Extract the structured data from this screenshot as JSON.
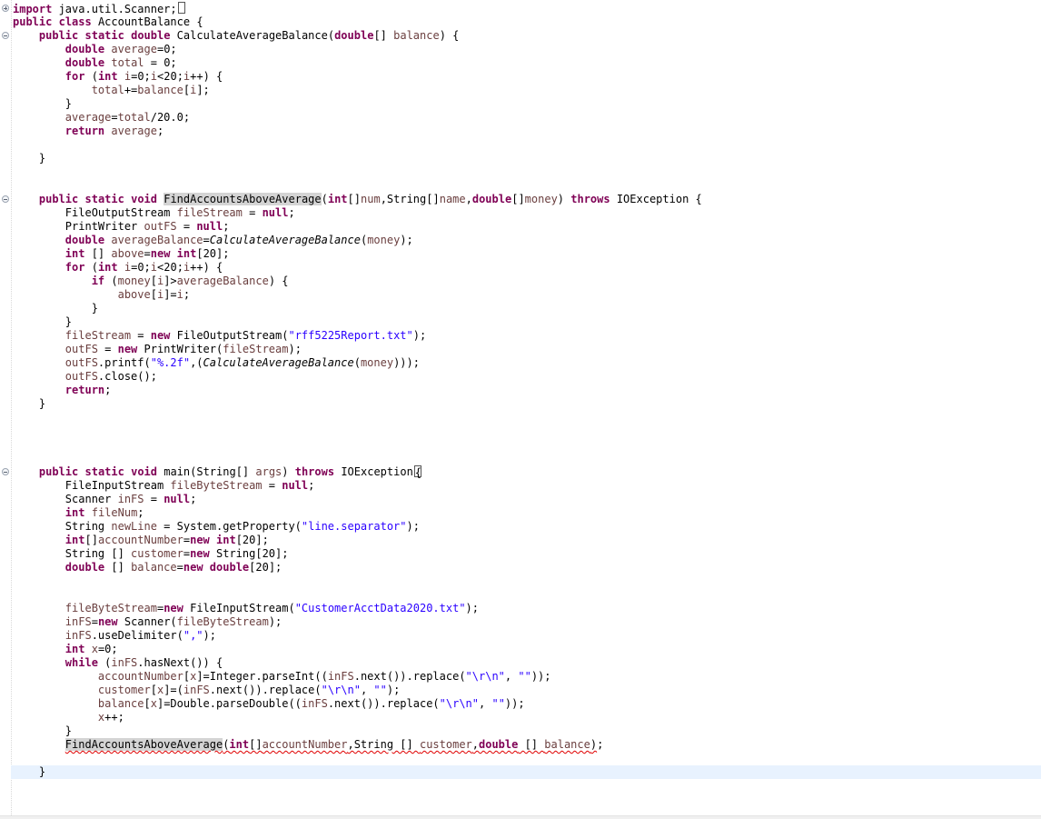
{
  "editor": {
    "lines": [
      [
        [
          "kw",
          "import"
        ],
        [
          "t",
          " java.util.Scanner;"
        ],
        [
          "box",
          ""
        ]
      ],
      [
        [
          "kw",
          "public"
        ],
        [
          "t",
          " "
        ],
        [
          "kw",
          "class"
        ],
        [
          "t",
          " AccountBalance {"
        ]
      ],
      [
        [
          "t",
          "    "
        ],
        [
          "kw",
          "public"
        ],
        [
          "t",
          " "
        ],
        [
          "kw",
          "static"
        ],
        [
          "t",
          " "
        ],
        [
          "kw",
          "double"
        ],
        [
          "t",
          " CalculateAverageBalance("
        ],
        [
          "kw",
          "double"
        ],
        [
          "t",
          "[] "
        ],
        [
          "var",
          "balance"
        ],
        [
          "t",
          ") {"
        ]
      ],
      [
        [
          "t",
          "        "
        ],
        [
          "kw",
          "double"
        ],
        [
          "t",
          " "
        ],
        [
          "var",
          "average"
        ],
        [
          "t",
          "=0;"
        ]
      ],
      [
        [
          "t",
          "        "
        ],
        [
          "kw",
          "double"
        ],
        [
          "t",
          " "
        ],
        [
          "var",
          "total"
        ],
        [
          "t",
          " = 0;"
        ]
      ],
      [
        [
          "t",
          "        "
        ],
        [
          "kw",
          "for"
        ],
        [
          "t",
          " ("
        ],
        [
          "kw",
          "int"
        ],
        [
          "t",
          " "
        ],
        [
          "var",
          "i"
        ],
        [
          "t",
          "=0;"
        ],
        [
          "var",
          "i"
        ],
        [
          "t",
          "<20;"
        ],
        [
          "var",
          "i"
        ],
        [
          "t",
          "++) {"
        ]
      ],
      [
        [
          "t",
          "            "
        ],
        [
          "var",
          "total"
        ],
        [
          "t",
          "+="
        ],
        [
          "var",
          "balance"
        ],
        [
          "t",
          "["
        ],
        [
          "var",
          "i"
        ],
        [
          "t",
          "];"
        ]
      ],
      [
        [
          "t",
          "        }"
        ]
      ],
      [
        [
          "t",
          "        "
        ],
        [
          "var",
          "average"
        ],
        [
          "t",
          "="
        ],
        [
          "var",
          "total"
        ],
        [
          "t",
          "/20.0;"
        ]
      ],
      [
        [
          "t",
          "        "
        ],
        [
          "kw",
          "return"
        ],
        [
          "t",
          " "
        ],
        [
          "var",
          "average"
        ],
        [
          "t",
          ";"
        ]
      ],
      [
        [
          "t",
          ""
        ]
      ],
      [
        [
          "t",
          "    }"
        ]
      ],
      [
        [
          "t",
          ""
        ]
      ],
      [
        [
          "t",
          ""
        ]
      ],
      [
        [
          "t",
          "    "
        ],
        [
          "kw",
          "public"
        ],
        [
          "t",
          " "
        ],
        [
          "kw",
          "static"
        ],
        [
          "t",
          " "
        ],
        [
          "kw",
          "void"
        ],
        [
          "t",
          " "
        ],
        [
          "occ",
          "FindAccountsAboveAverage"
        ],
        [
          "t",
          "("
        ],
        [
          "kw",
          "int"
        ],
        [
          "t",
          "[]"
        ],
        [
          "var",
          "num"
        ],
        [
          "t",
          ",String[]"
        ],
        [
          "var",
          "name"
        ],
        [
          "t",
          ","
        ],
        [
          "kw",
          "double"
        ],
        [
          "t",
          "[]"
        ],
        [
          "var",
          "money"
        ],
        [
          "t",
          ") "
        ],
        [
          "kw",
          "throws"
        ],
        [
          "t",
          " IOException {"
        ]
      ],
      [
        [
          "t",
          "        FileOutputStream "
        ],
        [
          "var",
          "fileStream"
        ],
        [
          "t",
          " = "
        ],
        [
          "kw",
          "null"
        ],
        [
          "t",
          ";"
        ]
      ],
      [
        [
          "t",
          "        PrintWriter "
        ],
        [
          "var",
          "outFS"
        ],
        [
          "t",
          " = "
        ],
        [
          "kw",
          "null"
        ],
        [
          "t",
          ";"
        ]
      ],
      [
        [
          "t",
          "        "
        ],
        [
          "kw",
          "double"
        ],
        [
          "t",
          " "
        ],
        [
          "var",
          "averageBalance"
        ],
        [
          "t",
          "="
        ],
        [
          "it",
          "CalculateAverageBalance"
        ],
        [
          "t",
          "("
        ],
        [
          "var",
          "money"
        ],
        [
          "t",
          ");"
        ]
      ],
      [
        [
          "t",
          "        "
        ],
        [
          "kw",
          "int"
        ],
        [
          "t",
          " [] "
        ],
        [
          "var",
          "above"
        ],
        [
          "t",
          "="
        ],
        [
          "kw",
          "new"
        ],
        [
          "t",
          " "
        ],
        [
          "kw",
          "int"
        ],
        [
          "t",
          "[20];"
        ]
      ],
      [
        [
          "t",
          "        "
        ],
        [
          "kw",
          "for"
        ],
        [
          "t",
          " ("
        ],
        [
          "kw",
          "int"
        ],
        [
          "t",
          " "
        ],
        [
          "var",
          "i"
        ],
        [
          "t",
          "=0;"
        ],
        [
          "var",
          "i"
        ],
        [
          "t",
          "<20;"
        ],
        [
          "var",
          "i"
        ],
        [
          "t",
          "++) {"
        ]
      ],
      [
        [
          "t",
          "            "
        ],
        [
          "kw",
          "if"
        ],
        [
          "t",
          " ("
        ],
        [
          "var",
          "money"
        ],
        [
          "t",
          "["
        ],
        [
          "var",
          "i"
        ],
        [
          "t",
          "]>"
        ],
        [
          "var",
          "averageBalance"
        ],
        [
          "t",
          ") {"
        ]
      ],
      [
        [
          "t",
          "                "
        ],
        [
          "var",
          "above"
        ],
        [
          "t",
          "["
        ],
        [
          "var",
          "i"
        ],
        [
          "t",
          "]="
        ],
        [
          "var",
          "i"
        ],
        [
          "t",
          ";"
        ]
      ],
      [
        [
          "t",
          "            }"
        ]
      ],
      [
        [
          "t",
          "        }"
        ]
      ],
      [
        [
          "t",
          "        "
        ],
        [
          "var",
          "fileStream"
        ],
        [
          "t",
          " = "
        ],
        [
          "kw",
          "new"
        ],
        [
          "t",
          " FileOutputStream("
        ],
        [
          "str",
          "\"rff5225Report.txt\""
        ],
        [
          "t",
          ");"
        ]
      ],
      [
        [
          "t",
          "        "
        ],
        [
          "var",
          "outFS"
        ],
        [
          "t",
          " = "
        ],
        [
          "kw",
          "new"
        ],
        [
          "t",
          " PrintWriter("
        ],
        [
          "var",
          "fileStream"
        ],
        [
          "t",
          ");"
        ]
      ],
      [
        [
          "t",
          "        "
        ],
        [
          "var",
          "outFS"
        ],
        [
          "t",
          ".printf("
        ],
        [
          "str",
          "\"%.2f\""
        ],
        [
          "t",
          ",("
        ],
        [
          "it",
          "CalculateAverageBalance"
        ],
        [
          "t",
          "("
        ],
        [
          "var",
          "money"
        ],
        [
          "t",
          ")));"
        ]
      ],
      [
        [
          "t",
          "        "
        ],
        [
          "var",
          "outFS"
        ],
        [
          "t",
          ".close();"
        ]
      ],
      [
        [
          "t",
          "        "
        ],
        [
          "kw",
          "return"
        ],
        [
          "t",
          ";"
        ]
      ],
      [
        [
          "t",
          "    }"
        ]
      ],
      [
        [
          "t",
          ""
        ]
      ],
      [
        [
          "t",
          ""
        ]
      ],
      [
        [
          "t",
          ""
        ]
      ],
      [
        [
          "t",
          ""
        ]
      ],
      [
        [
          "t",
          "    "
        ],
        [
          "kw",
          "public"
        ],
        [
          "t",
          " "
        ],
        [
          "kw",
          "static"
        ],
        [
          "t",
          " "
        ],
        [
          "kw",
          "void"
        ],
        [
          "t",
          " main(String[] "
        ],
        [
          "var",
          "args"
        ],
        [
          "t",
          ") "
        ],
        [
          "kw",
          "throws"
        ],
        [
          "t",
          " IOException"
        ],
        [
          "box",
          "{"
        ]
      ],
      [
        [
          "t",
          "        FileInputStream "
        ],
        [
          "var",
          "fileByteStream"
        ],
        [
          "t",
          " = "
        ],
        [
          "kw",
          "null"
        ],
        [
          "t",
          ";"
        ]
      ],
      [
        [
          "t",
          "        Scanner "
        ],
        [
          "var",
          "inFS"
        ],
        [
          "t",
          " = "
        ],
        [
          "kw",
          "null"
        ],
        [
          "t",
          ";"
        ]
      ],
      [
        [
          "t",
          "        "
        ],
        [
          "kw",
          "int"
        ],
        [
          "t",
          " "
        ],
        [
          "var",
          "fileNum"
        ],
        [
          "t",
          ";"
        ]
      ],
      [
        [
          "t",
          "        String "
        ],
        [
          "var",
          "newLine"
        ],
        [
          "t",
          " = System.getProperty("
        ],
        [
          "str",
          "\"line.separator\""
        ],
        [
          "t",
          ");"
        ]
      ],
      [
        [
          "t",
          "        "
        ],
        [
          "kw",
          "int"
        ],
        [
          "t",
          "[]"
        ],
        [
          "var",
          "accountNumber"
        ],
        [
          "t",
          "="
        ],
        [
          "kw",
          "new"
        ],
        [
          "t",
          " "
        ],
        [
          "kw",
          "int"
        ],
        [
          "t",
          "[20];"
        ]
      ],
      [
        [
          "t",
          "        String [] "
        ],
        [
          "var",
          "customer"
        ],
        [
          "t",
          "="
        ],
        [
          "kw",
          "new"
        ],
        [
          "t",
          " String[20];"
        ]
      ],
      [
        [
          "t",
          "        "
        ],
        [
          "kw",
          "double"
        ],
        [
          "t",
          " [] "
        ],
        [
          "var",
          "balance"
        ],
        [
          "t",
          "="
        ],
        [
          "kw",
          "new"
        ],
        [
          "t",
          " "
        ],
        [
          "kw",
          "double"
        ],
        [
          "t",
          "[20];"
        ]
      ],
      [
        [
          "t",
          ""
        ]
      ],
      [
        [
          "t",
          ""
        ]
      ],
      [
        [
          "t",
          "        "
        ],
        [
          "var",
          "fileByteStream"
        ],
        [
          "t",
          "="
        ],
        [
          "kw",
          "new"
        ],
        [
          "t",
          " FileInputStream("
        ],
        [
          "str",
          "\"CustomerAcctData2020.txt\""
        ],
        [
          "t",
          ");"
        ]
      ],
      [
        [
          "t",
          "        "
        ],
        [
          "var",
          "inFS"
        ],
        [
          "t",
          "="
        ],
        [
          "kw",
          "new"
        ],
        [
          "t",
          " Scanner("
        ],
        [
          "var",
          "fileByteStream"
        ],
        [
          "t",
          ");"
        ]
      ],
      [
        [
          "t",
          "        "
        ],
        [
          "var",
          "inFS"
        ],
        [
          "t",
          ".useDelimiter("
        ],
        [
          "str",
          "\",\""
        ],
        [
          "t",
          ");"
        ]
      ],
      [
        [
          "t",
          "        "
        ],
        [
          "kw",
          "int"
        ],
        [
          "t",
          " "
        ],
        [
          "var",
          "x"
        ],
        [
          "t",
          "=0;"
        ]
      ],
      [
        [
          "t",
          "        "
        ],
        [
          "kw",
          "while"
        ],
        [
          "t",
          " ("
        ],
        [
          "var",
          "inFS"
        ],
        [
          "t",
          ".hasNext()) {"
        ]
      ],
      [
        [
          "t",
          "             "
        ],
        [
          "var",
          "accountNumber"
        ],
        [
          "t",
          "["
        ],
        [
          "var",
          "x"
        ],
        [
          "t",
          "]=Integer.parseInt(("
        ],
        [
          "var",
          "inFS"
        ],
        [
          "t",
          ".next()).replace("
        ],
        [
          "str",
          "\"\\r\\n\""
        ],
        [
          "t",
          ", "
        ],
        [
          "str",
          "\"\""
        ],
        [
          "t",
          "));"
        ]
      ],
      [
        [
          "t",
          "             "
        ],
        [
          "var",
          "customer"
        ],
        [
          "t",
          "["
        ],
        [
          "var",
          "x"
        ],
        [
          "t",
          "]=("
        ],
        [
          "var",
          "inFS"
        ],
        [
          "t",
          ".next()).replace("
        ],
        [
          "str",
          "\"\\r\\n\""
        ],
        [
          "t",
          ", "
        ],
        [
          "str",
          "\"\""
        ],
        [
          "t",
          ");"
        ]
      ],
      [
        [
          "t",
          "             "
        ],
        [
          "var",
          "balance"
        ],
        [
          "t",
          "["
        ],
        [
          "var",
          "x"
        ],
        [
          "t",
          "]=Double.parseDouble(("
        ],
        [
          "var",
          "inFS"
        ],
        [
          "t",
          ".next()).replace("
        ],
        [
          "str",
          "\"\\r\\n\""
        ],
        [
          "t",
          ", "
        ],
        [
          "str",
          "\"\""
        ],
        [
          "t",
          "));"
        ]
      ],
      [
        [
          "t",
          "             "
        ],
        [
          "var",
          "x"
        ],
        [
          "t",
          "++;"
        ]
      ],
      [
        [
          "t",
          "        }"
        ]
      ],
      [
        [
          "t",
          "        "
        ],
        [
          "err_occ",
          "FindAccountsAboveAverage"
        ],
        [
          "err",
          "("
        ],
        [
          "errkw",
          "int"
        ],
        [
          "err",
          "[]"
        ],
        [
          "errvar",
          "accountNumber"
        ],
        [
          "err",
          ",String [] "
        ],
        [
          "errvar",
          "customer"
        ],
        [
          "err",
          ","
        ],
        [
          "errkw",
          "double"
        ],
        [
          "err",
          " [] "
        ],
        [
          "errvar",
          "balance"
        ],
        [
          "err",
          ")"
        ],
        [
          "t",
          ";"
        ]
      ],
      [
        [
          "t",
          ""
        ]
      ],
      [
        [
          "t",
          "    }"
        ]
      ]
    ],
    "current_line_index": 56
  }
}
